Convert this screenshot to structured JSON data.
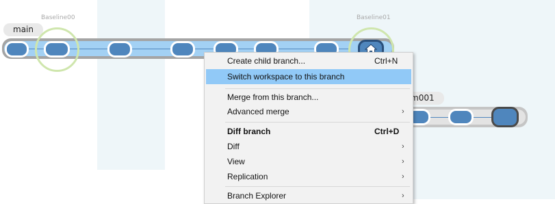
{
  "baselines": [
    "Baseline00",
    "Baseline01"
  ],
  "branches": {
    "main": {
      "label": "main"
    },
    "secondary": {
      "label": "m001"
    }
  },
  "colors": {
    "changeset": "#4f86bd",
    "branch_fill": "#a3d1f4",
    "label_halo": "#cfe6ad",
    "menu_highlight": "#91c9f7"
  },
  "icons": {
    "current_changeset": "home-icon"
  },
  "context_menu": {
    "items": [
      {
        "label": "Create child branch...",
        "shortcut": "Ctrl+N"
      },
      {
        "label": "Switch workspace to this branch",
        "highlighted": true
      },
      {
        "label": "Merge from this branch..."
      },
      {
        "label": "Advanced merge",
        "submenu": true
      },
      {
        "label": "Diff branch",
        "shortcut": "Ctrl+D",
        "bold": true
      },
      {
        "label": "Diff",
        "submenu": true
      },
      {
        "label": "View",
        "submenu": true
      },
      {
        "label": "Replication",
        "submenu": true
      },
      {
        "label": "Branch Explorer",
        "submenu": true
      }
    ]
  }
}
